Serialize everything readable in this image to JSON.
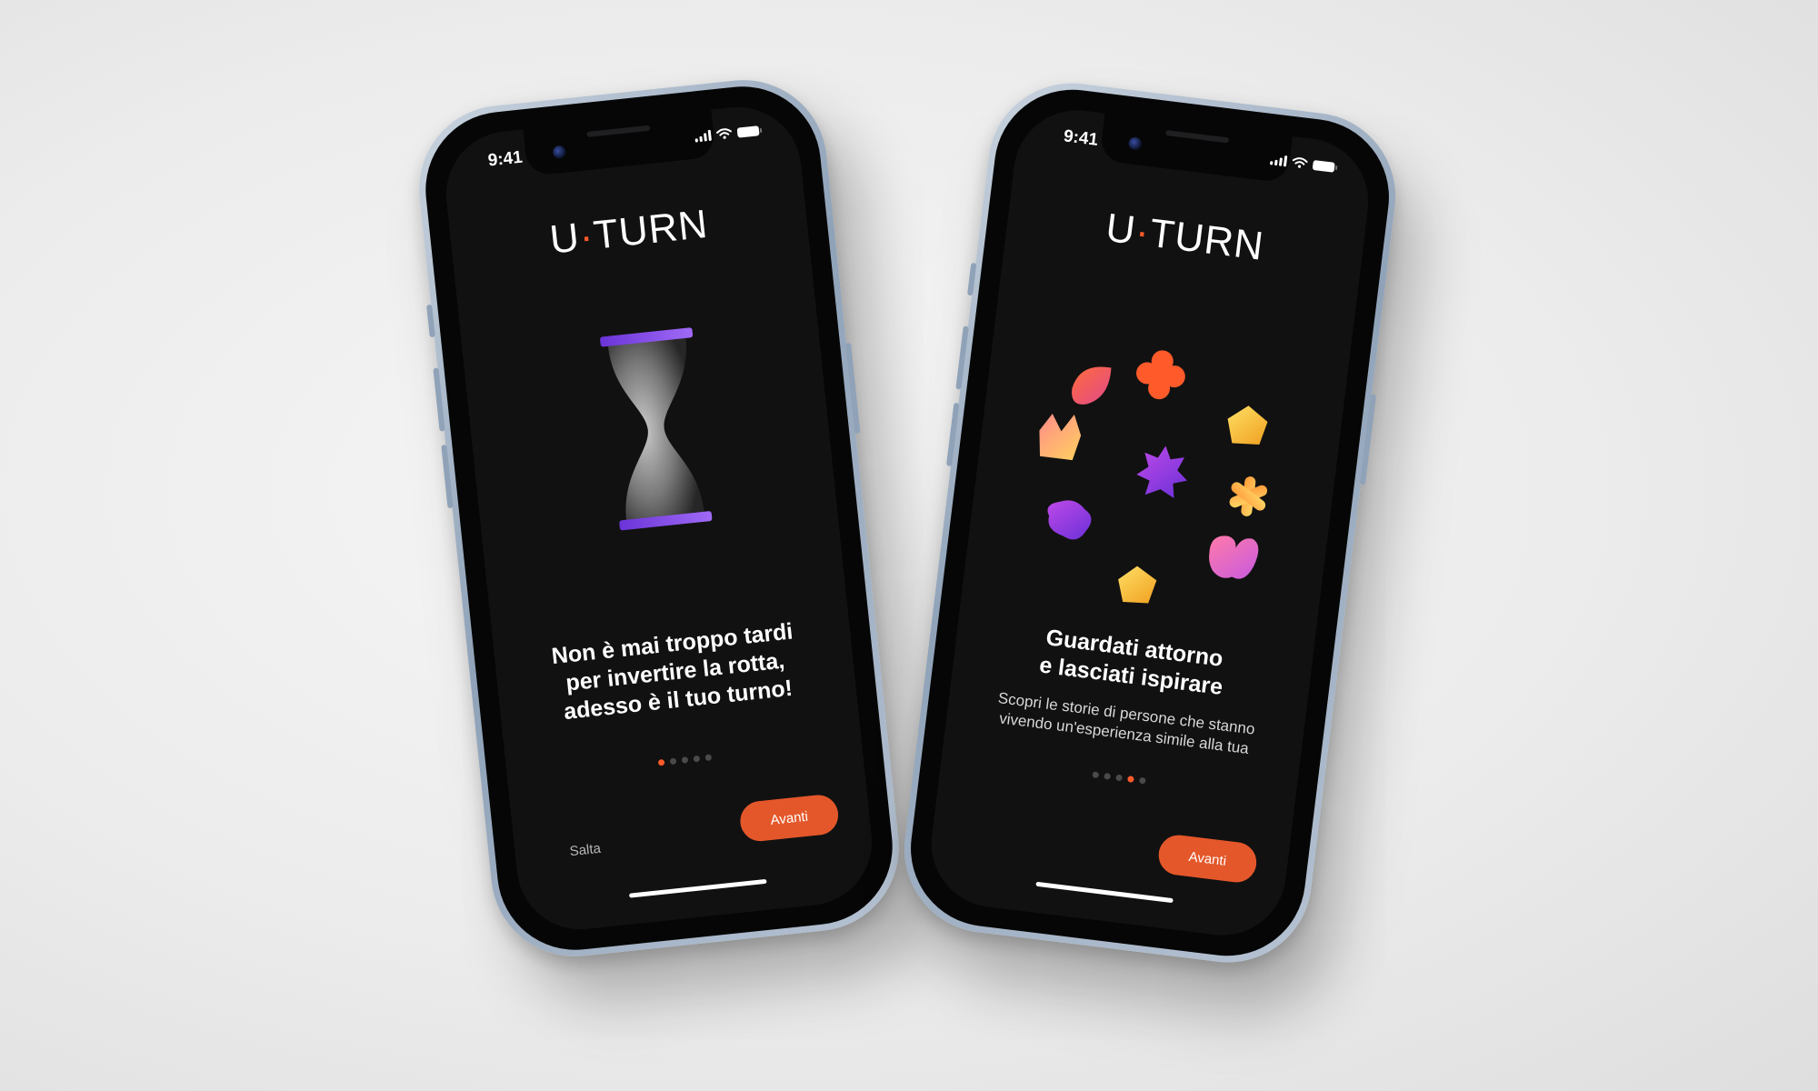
{
  "status_bar": {
    "time": "9:41"
  },
  "app": {
    "logo_main": "U",
    "logo_dot": "·",
    "logo_rest": "TURN"
  },
  "screen1": {
    "headline": "Non è mai troppo tardi\nper invertire la rotta,\nadesso è il tuo turno!",
    "illustration": "hourglass-icon",
    "pagination": {
      "total": 5,
      "active_index": 0
    },
    "skip_label": "Salta",
    "next_label": "Avanti"
  },
  "screen2": {
    "headline": "Guardati attorno\ne lasciati ispirare",
    "subtext": "Scopri le storie di persone che stanno\nvivendo un'esperienza simile alla tua",
    "illustration": "sticker-shapes",
    "pagination": {
      "total": 5,
      "active_index": 3
    },
    "next_label": "Avanti"
  },
  "colors": {
    "accent": "#e4572a",
    "screen_background": "#111111",
    "hourglass_cap": "#7b3fe4",
    "frame": "#a9b7c8"
  }
}
